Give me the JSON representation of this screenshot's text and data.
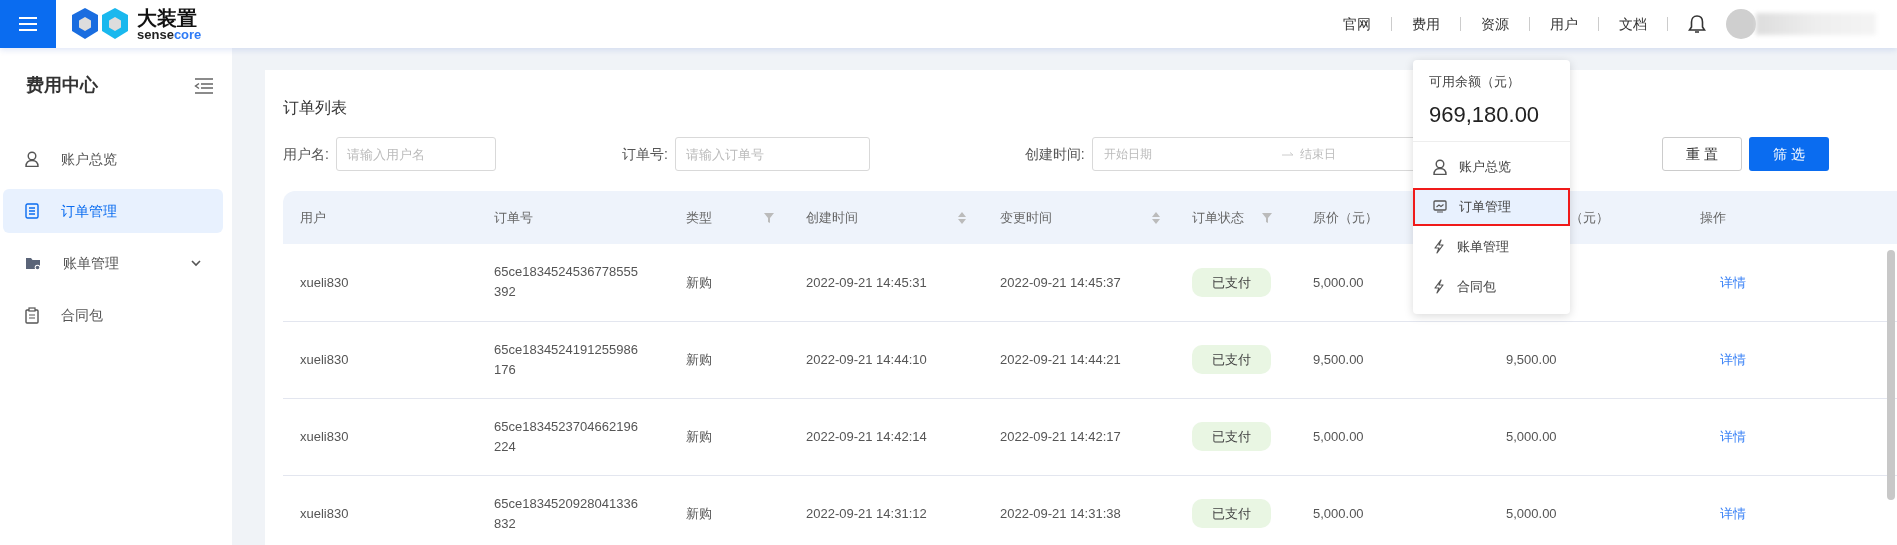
{
  "topbar": {
    "brand_cn": "大装置",
    "brand_en_a": "sense",
    "brand_en_b": "core",
    "nav": [
      {
        "label": "官网"
      },
      {
        "label": "费用"
      },
      {
        "label": "资源"
      },
      {
        "label": "用户"
      },
      {
        "label": "文档"
      }
    ]
  },
  "sidebar": {
    "title": "费用中心",
    "items": [
      {
        "label": "账户总览",
        "kind": "person",
        "selected": false
      },
      {
        "label": "订单管理",
        "kind": "list",
        "selected": true
      },
      {
        "label": "账单管理",
        "kind": "folder",
        "selected": false,
        "expanded": false
      },
      {
        "label": "合同包",
        "kind": "clipboard",
        "selected": false
      }
    ]
  },
  "card": {
    "title": "订单列表"
  },
  "filters": {
    "user_label": "用户名:",
    "user_placeholder": "请输入用户名",
    "order_label": "订单号:",
    "order_placeholder": "请输入订单号",
    "time_label": "创建时间:",
    "start_placeholder": "开始日期",
    "end_placeholder": "结束日",
    "reset": "重 置",
    "submit": "筛 选"
  },
  "table": {
    "columns": [
      {
        "label": "用户",
        "kind": "plain"
      },
      {
        "label": "订单号",
        "kind": "plain"
      },
      {
        "label": "类型",
        "kind": "filter"
      },
      {
        "label": "创建时间",
        "kind": "sort"
      },
      {
        "label": "变更时间",
        "kind": "sort"
      },
      {
        "label": "订单状态",
        "kind": "filter"
      },
      {
        "label": "原价（元）",
        "kind": "plain"
      },
      {
        "label": "（元）",
        "kind": "covered"
      },
      {
        "label": "操作",
        "kind": "plain"
      }
    ],
    "rows": [
      {
        "user": "xueli830",
        "order": "65ce1834524536778555392",
        "type": "新购",
        "created": "2022-09-21 14:45:31",
        "changed": "2022-09-21 14:45:37",
        "status": "已支付",
        "price": "5,000.00",
        "action": "详情"
      },
      {
        "user": "xueli830",
        "order": "65ce1834524191255986176",
        "type": "新购",
        "created": "2022-09-21 14:44:10",
        "changed": "2022-09-21 14:44:21",
        "status": "已支付",
        "price": "9,500.00",
        "paid": "9,500.00",
        "action": "详情"
      },
      {
        "user": "xueli830",
        "order": "65ce1834523704662196224",
        "type": "新购",
        "created": "2022-09-21 14:42:14",
        "changed": "2022-09-21 14:42:17",
        "status": "已支付",
        "price": "5,000.00",
        "paid": "5,000.00",
        "action": "详情"
      },
      {
        "user": "xueli830",
        "order": "65ce1834520928041336832",
        "type": "新购",
        "created": "2022-09-21 14:31:12",
        "changed": "2022-09-21 14:31:38",
        "status": "已支付",
        "price": "5,000.00",
        "paid": "5,000.00",
        "action": "详情"
      }
    ]
  },
  "dropdown": {
    "balance_label": "可用余额（元）",
    "balance": "969,180.00",
    "items": [
      {
        "label": "账户总览",
        "kind": "person",
        "selected": false
      },
      {
        "label": "订单管理",
        "kind": "monitor",
        "selected": true
      },
      {
        "label": "账单管理",
        "kind": "bolt",
        "selected": false
      },
      {
        "label": "合同包",
        "kind": "bolt",
        "selected": false
      }
    ]
  }
}
